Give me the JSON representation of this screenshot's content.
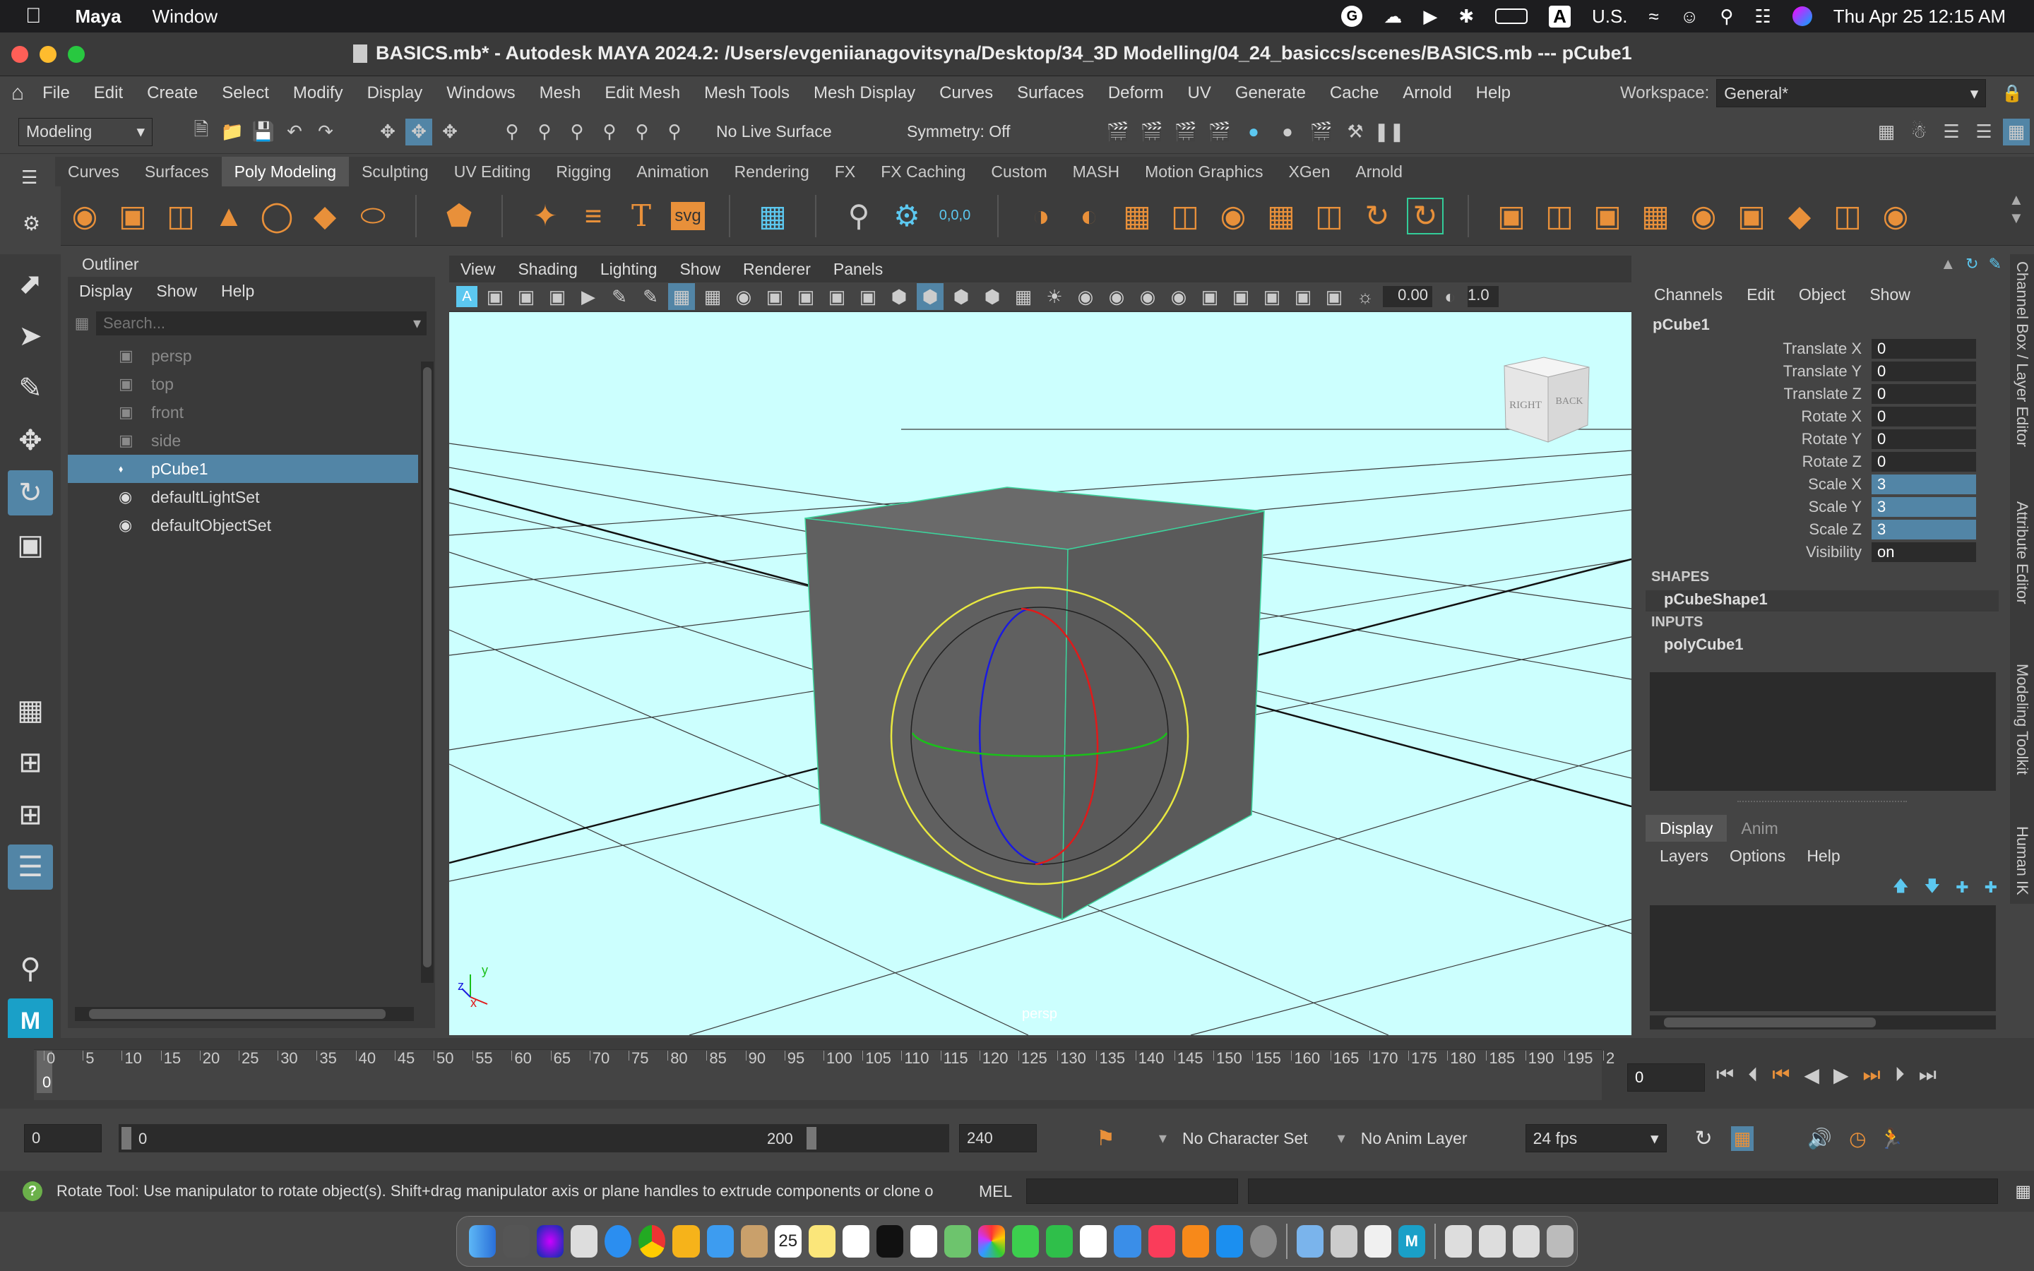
{
  "macos_menubar": {
    "app": "Maya",
    "items": [
      "Window"
    ],
    "input_source": "U.S.",
    "datetime": "Thu Apr 25  12:15 AM"
  },
  "window": {
    "title": "BASICS.mb* - Autodesk MAYA 2024.2: /Users/evgeniianagovitsyna/Desktop/34_3D Modelling/04_24_basiccs/scenes/BASICS.mb  ---  pCube1"
  },
  "main_menu": {
    "items": [
      "File",
      "Edit",
      "Create",
      "Select",
      "Modify",
      "Display",
      "Windows",
      "Mesh",
      "Edit Mesh",
      "Mesh Tools",
      "Mesh Display",
      "Curves",
      "Surfaces",
      "Deform",
      "UV",
      "Generate",
      "Cache",
      "Arnold",
      "Help"
    ],
    "workspace_label": "Workspace:",
    "workspace_value": "General*"
  },
  "status_line": {
    "mode": "Modeling",
    "live_surface": "No Live Surface",
    "symmetry": "Symmetry: Off"
  },
  "shelf": {
    "tabs": [
      "Curves",
      "Surfaces",
      "Poly Modeling",
      "Sculpting",
      "UV Editing",
      "Rigging",
      "Animation",
      "Rendering",
      "FX",
      "FX Caching",
      "Custom",
      "MASH",
      "Motion Graphics",
      "XGen",
      "Arnold"
    ],
    "active_tab": "Poly Modeling",
    "text_icon": "T",
    "svg_icon": "svg",
    "snap_readout": "0,0,0"
  },
  "outliner": {
    "title": "Outliner",
    "menu": [
      "Display",
      "Show",
      "Help"
    ],
    "search_placeholder": "Search...",
    "items": [
      {
        "label": "persp",
        "type": "camera",
        "dim": true
      },
      {
        "label": "top",
        "type": "camera",
        "dim": true
      },
      {
        "label": "front",
        "type": "camera",
        "dim": true
      },
      {
        "label": "side",
        "type": "camera",
        "dim": true
      },
      {
        "label": "pCube1",
        "type": "mesh",
        "selected": true
      },
      {
        "label": "defaultLightSet",
        "type": "set"
      },
      {
        "label": "defaultObjectSet",
        "type": "set"
      }
    ]
  },
  "viewport": {
    "menu": [
      "View",
      "Shading",
      "Lighting",
      "Show",
      "Renderer",
      "Panels"
    ],
    "field1": "0.00",
    "field2": "1.0",
    "camera_label": "persp",
    "viewcube_right": "RIGHT",
    "viewcube_back": "BACK",
    "axis_y": "y",
    "axis_z": "z",
    "axis_x": "x",
    "background": "#ccfffe"
  },
  "channel_box": {
    "menu": [
      "Channels",
      "Edit",
      "Object",
      "Show"
    ],
    "object": "pCube1",
    "channels": [
      {
        "label": "Translate X",
        "value": "0"
      },
      {
        "label": "Translate Y",
        "value": "0"
      },
      {
        "label": "Translate Z",
        "value": "0"
      },
      {
        "label": "Rotate X",
        "value": "0"
      },
      {
        "label": "Rotate Y",
        "value": "0"
      },
      {
        "label": "Rotate Z",
        "value": "0"
      },
      {
        "label": "Scale X",
        "value": "3",
        "hl": true
      },
      {
        "label": "Scale Y",
        "value": "3",
        "hl": true
      },
      {
        "label": "Scale Z",
        "value": "3",
        "hl": true
      },
      {
        "label": "Visibility",
        "value": "on"
      }
    ],
    "shapes_header": "SHAPES",
    "shape": "pCubeShape1",
    "inputs_header": "INPUTS",
    "input": "polyCube1"
  },
  "layer_editor": {
    "tabs": [
      "Display",
      "Anim"
    ],
    "menu": [
      "Layers",
      "Options",
      "Help"
    ]
  },
  "side_tabs": [
    "Channel Box / Layer Editor",
    "Attribute Editor",
    "Modeling Toolkit",
    "Human IK"
  ],
  "timeline": {
    "ticks": [
      "0",
      "5",
      "10",
      "15",
      "20",
      "25",
      "30",
      "35",
      "40",
      "45",
      "50",
      "55",
      "60",
      "65",
      "70",
      "75",
      "80",
      "85",
      "90",
      "95",
      "100",
      "105",
      "110",
      "115",
      "120",
      "125",
      "130",
      "135",
      "140",
      "145",
      "150",
      "155",
      "160",
      "165",
      "170",
      "175",
      "180",
      "185",
      "190",
      "195",
      "2"
    ],
    "current_marker": "0",
    "current_frame": "0"
  },
  "range_slider": {
    "start": "0",
    "range_start": "0",
    "range_end": "200",
    "end": "240",
    "character_set": "No Character Set",
    "anim_layer": "No Anim Layer",
    "fps": "24 fps"
  },
  "help_line": {
    "text": "Rotate Tool: Use manipulator to rotate object(s). Shift+drag manipulator axis or plane handles to extrude components or clone o",
    "mel_label": "MEL"
  },
  "dock": {
    "calendar_day": "25"
  }
}
